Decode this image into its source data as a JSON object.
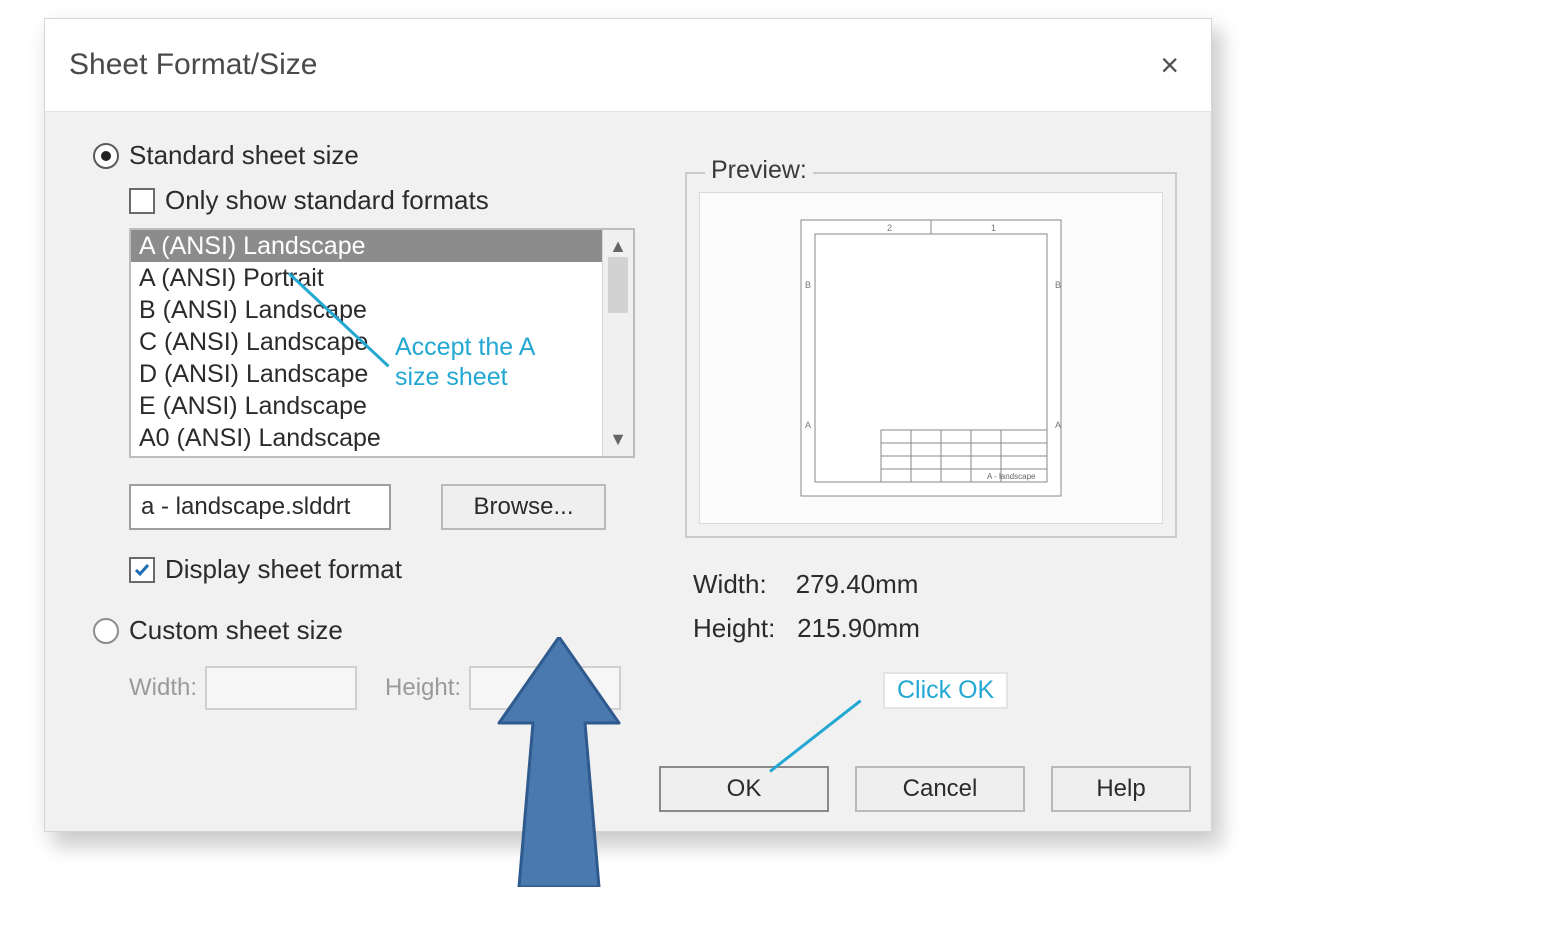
{
  "dialog": {
    "title": "Sheet Format/Size",
    "close_icon": "×"
  },
  "standard": {
    "radio_label": "Standard sheet size",
    "only_standard_label": "Only show standard formats",
    "formats": [
      "A (ANSI) Landscape",
      "A (ANSI) Portrait",
      "B (ANSI) Landscape",
      "C (ANSI) Landscape",
      "D (ANSI) Landscape",
      "E (ANSI) Landscape",
      "A0 (ANSI) Landscape"
    ],
    "selected_index": 0,
    "file_name": "a - landscape.slddrt",
    "browse_label": "Browse...",
    "display_format_label": "Display sheet format"
  },
  "custom": {
    "radio_label": "Custom sheet size",
    "width_label": "Width:",
    "height_label": "Height:"
  },
  "preview": {
    "group_label": "Preview:",
    "width_label": "Width:",
    "width_value": "279.40mm",
    "height_label": "Height:",
    "height_value": "215.90mm",
    "thumb_caption": "A - landscape"
  },
  "buttons": {
    "ok": "OK",
    "cancel": "Cancel",
    "help": "Help"
  },
  "annotations": {
    "accept_line1": "Accept the A",
    "accept_line2": "size sheet",
    "click_ok": "Click OK"
  }
}
